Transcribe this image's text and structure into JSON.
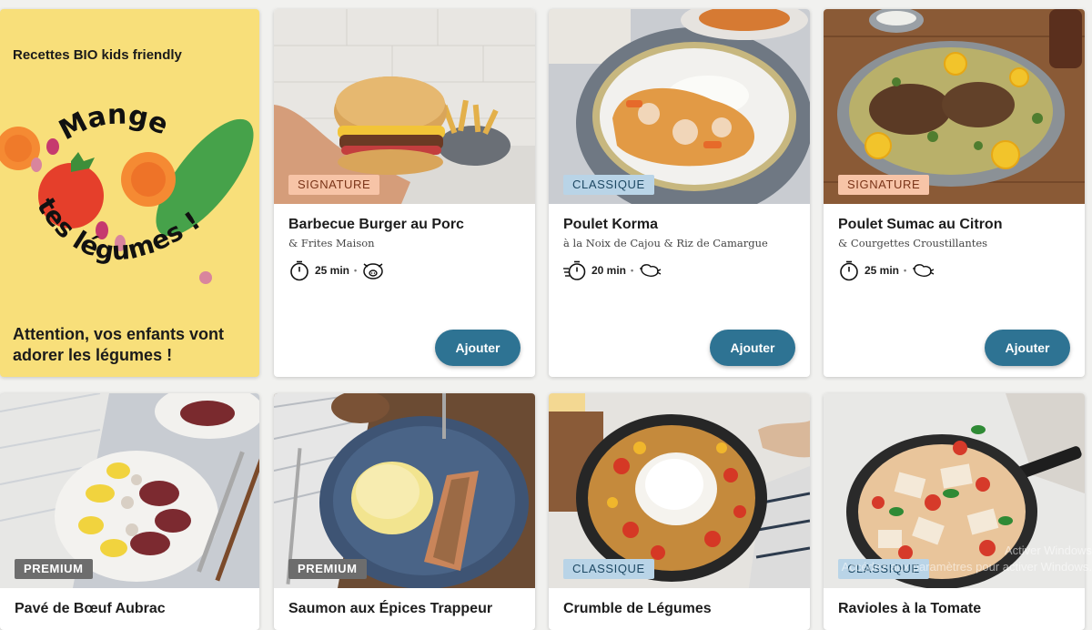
{
  "promo": {
    "kicker": "Recettes BIO kids friendly",
    "logo_line1": "Mange",
    "logo_line2": "tes légumes !",
    "tagline": "Attention, vos enfants vont adorer les légumes !"
  },
  "recipes": [
    {
      "badge": "SIGNATURE",
      "title": "Barbecue Burger au Porc",
      "subtitle": "& Frites Maison",
      "time": "25 min",
      "time_icon": "stopwatch-icon",
      "diet_icon": "pig-icon",
      "button": "Ajouter"
    },
    {
      "badge": "CLASSIQUE",
      "title": "Poulet Korma",
      "subtitle": "à la Noix de Cajou & Riz de Camargue",
      "time": "20 min",
      "time_icon": "fast-stopwatch-icon",
      "diet_icon": "chicken-icon",
      "button": "Ajouter"
    },
    {
      "badge": "SIGNATURE",
      "title": "Poulet Sumac au Citron",
      "subtitle": "& Courgettes Croustillantes",
      "time": "25 min",
      "time_icon": "stopwatch-icon",
      "diet_icon": "chicken-icon",
      "button": "Ajouter"
    },
    {
      "badge": "PREMIUM",
      "title": "Pavé de Bœuf Aubrac"
    },
    {
      "badge": "PREMIUM",
      "title": "Saumon aux Épices Trappeur"
    },
    {
      "badge": "CLASSIQUE",
      "title": "Crumble de Légumes"
    },
    {
      "badge": "CLASSIQUE",
      "title": "Ravioles à la Tomate"
    }
  ],
  "os_watermark": {
    "line1": "Activer Windows",
    "line2": "Accédez aux paramètres pour activer Windows."
  },
  "colors": {
    "accent": "#2e7393",
    "promo_bg": "#f8df7a",
    "signature_badge": "#f7c4a7",
    "classique_badge": "#b9d4e7",
    "premium_badge": "#6d6d6d"
  }
}
